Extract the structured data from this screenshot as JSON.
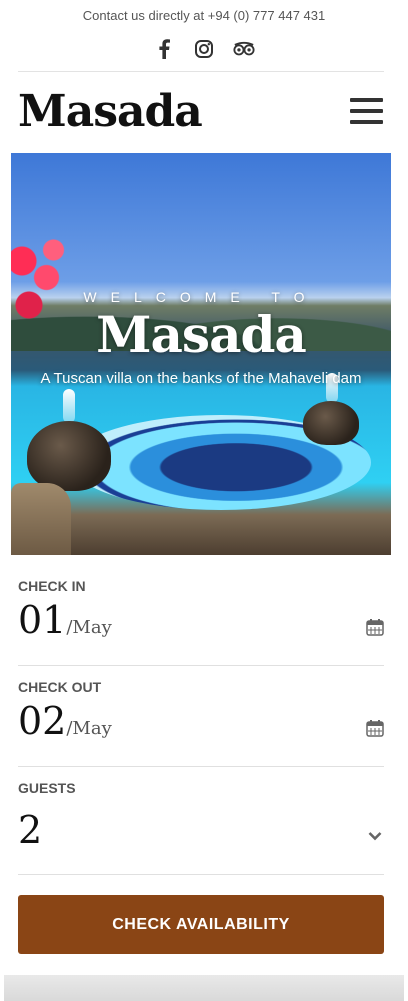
{
  "header": {
    "contact_text": "Contact us directly at +94 (0) 777 447 431",
    "social_icons": [
      "facebook-icon",
      "instagram-icon",
      "tripadvisor-icon"
    ],
    "logo": "Masada",
    "menu_icon": "hamburger-menu-icon"
  },
  "hero": {
    "welcome": "WELCOME TO",
    "title": "Masada",
    "subtitle": "A Tuscan villa on the banks of the Mahaveli dam"
  },
  "booking": {
    "check_in": {
      "label": "CHECK IN",
      "day": "01",
      "month": "/May",
      "icon": "calendar-icon"
    },
    "check_out": {
      "label": "CHECK OUT",
      "day": "02",
      "month": "/May",
      "icon": "calendar-icon"
    },
    "guests": {
      "label": "GUESTS",
      "value": "2",
      "icon": "chevron-down-icon"
    },
    "button_label": "CHECK AVAILABILITY"
  },
  "colors": {
    "button": "#8a4515",
    "text": "#111111",
    "label": "#555555"
  }
}
